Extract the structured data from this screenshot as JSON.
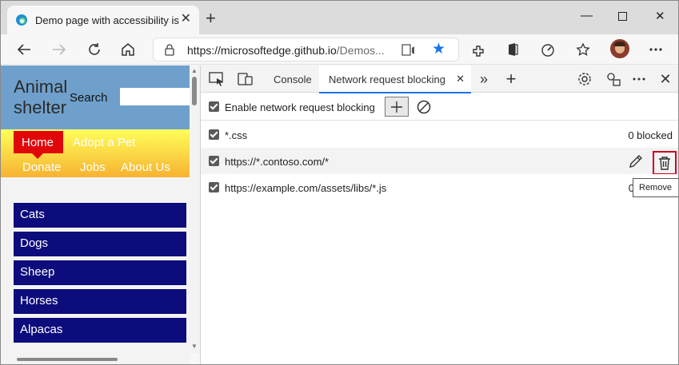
{
  "browser": {
    "tab_title": "Demo page with accessibility issues",
    "new_tab_symbol": "+",
    "url_host": "https://microsoftedge.github.io",
    "url_path": "/Demos...",
    "accent_color": "#1a73e8"
  },
  "page": {
    "logo_line1": "Animal",
    "logo_line2": "shelter",
    "search_label": "Search",
    "menu": {
      "home": "Home",
      "adopt": "Adopt a Pet",
      "donate": "Donate",
      "jobs": "Jobs",
      "about": "About Us"
    },
    "pets": [
      "Cats",
      "Dogs",
      "Sheep",
      "Horses",
      "Alpacas"
    ],
    "colors": {
      "header": "#6fa0cc",
      "home": "#e0070b",
      "nav": "#0c0c7d"
    }
  },
  "devtools": {
    "tabs": {
      "console": "Console",
      "network_request_blocking": "Network request blocking"
    },
    "enable_label": "Enable network request blocking",
    "patterns": [
      {
        "pattern": "*.css",
        "status": "0 blocked"
      },
      {
        "pattern": "https://*.contoso.com/*",
        "status": ""
      },
      {
        "pattern": "https://example.com/assets/libs/*.js",
        "status": "0"
      }
    ],
    "tooltip": "Remove",
    "highlight_color": "#d0021b"
  }
}
